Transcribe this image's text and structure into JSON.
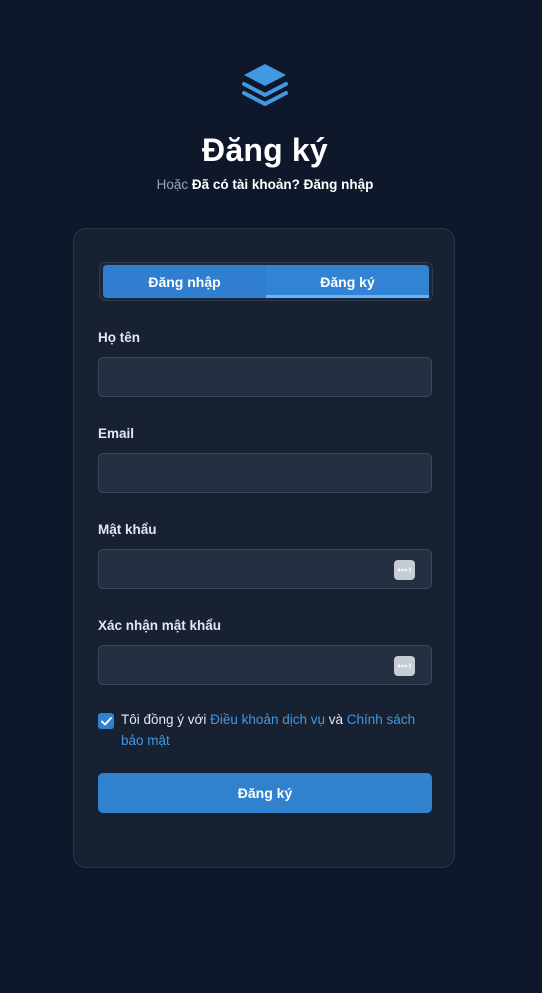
{
  "logo": {
    "icon": "layers-icon",
    "color": "#4299e1"
  },
  "header": {
    "title": "Đăng ký",
    "subtitle_prefix": "Hoặc",
    "subtitle_link": "Đã có tài khoản? Đăng nhập"
  },
  "tabs": [
    {
      "label": "Đăng nhập",
      "active": false
    },
    {
      "label": "Đăng ký",
      "active": true
    }
  ],
  "form": {
    "fullname": {
      "label": "Họ tên",
      "value": ""
    },
    "email": {
      "label": "Email",
      "value": ""
    },
    "password": {
      "label": "Mật khẩu",
      "value": "",
      "icon": "password-dots-icon"
    },
    "confirm_password": {
      "label": "Xác nhận mật khẩu",
      "value": "",
      "icon": "password-dots-icon"
    },
    "terms": {
      "checked": true,
      "text_prefix": "Tôi đồng ý với",
      "terms_link": "Điều khoản dịch vụ",
      "conjunction": "và",
      "privacy_link": "Chính sách bảo mật"
    },
    "submit_label": "Đăng ký"
  },
  "colors": {
    "background": "#0f172a",
    "card": "#172131",
    "accent": "#3182ce",
    "link": "#4299e1"
  }
}
